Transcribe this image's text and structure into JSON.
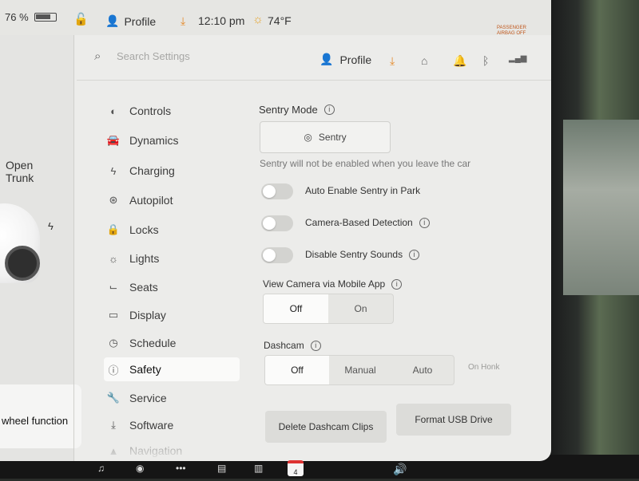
{
  "status": {
    "battery_percent": "76 %",
    "profile": "Profile",
    "time": "12:10 pm",
    "temperature": "74°F",
    "airbag_line1": "PASSENGER",
    "airbag_line2": "AIRBAG OFF"
  },
  "car_panel": {
    "trunk_line1": "Open",
    "trunk_line2": "Trunk",
    "wheel_function": "wheel function"
  },
  "header": {
    "search_placeholder": "Search Settings",
    "profile": "Profile"
  },
  "nav": {
    "items": [
      {
        "label": "Controls",
        "icon": "toggle-icon"
      },
      {
        "label": "Dynamics",
        "icon": "car-icon"
      },
      {
        "label": "Charging",
        "icon": "bolt-icon"
      },
      {
        "label": "Autopilot",
        "icon": "steering-wheel-icon"
      },
      {
        "label": "Locks",
        "icon": "lock-icon"
      },
      {
        "label": "Lights",
        "icon": "light-icon"
      },
      {
        "label": "Seats",
        "icon": "seat-icon"
      },
      {
        "label": "Display",
        "icon": "display-icon"
      },
      {
        "label": "Schedule",
        "icon": "clock-icon"
      },
      {
        "label": "Safety",
        "icon": "alert-icon"
      },
      {
        "label": "Service",
        "icon": "wrench-icon"
      },
      {
        "label": "Software",
        "icon": "download-icon"
      },
      {
        "label": "Navigation",
        "icon": "navigation-icon"
      }
    ],
    "active": "Safety"
  },
  "sentry": {
    "title": "Sentry Mode",
    "button_label": "Sentry",
    "note": "Sentry will not be enabled when you leave the car",
    "toggles": [
      {
        "label": "Auto Enable Sentry in Park",
        "on": false,
        "info": false
      },
      {
        "label": "Camera-Based Detection",
        "on": false,
        "info": true
      },
      {
        "label": "Disable Sentry Sounds",
        "on": false,
        "info": true
      }
    ]
  },
  "view_camera": {
    "title": "View Camera via Mobile App",
    "options": [
      "Off",
      "On"
    ],
    "selected": "Off"
  },
  "dashcam": {
    "title": "Dashcam",
    "options": [
      "Off",
      "Manual",
      "Auto"
    ],
    "extra_option": "On Honk",
    "selected": "Off"
  },
  "actions": {
    "delete_clips": "Delete Dashcam Clips",
    "format_usb": "Format USB Drive"
  },
  "taskbar": {
    "calendar_day": "4"
  },
  "colors": {
    "accent_orange": "#e58a2a",
    "screen_bg": "#ececea",
    "selected_segment": "#fbfbfa"
  }
}
